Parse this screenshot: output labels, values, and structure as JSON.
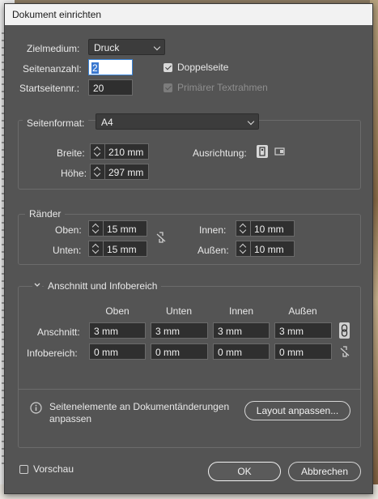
{
  "window": {
    "title": "Dokument einrichten"
  },
  "target": {
    "label": "Zielmedium:",
    "value": "Druck"
  },
  "pages": {
    "label": "Seitenanzahl:",
    "value": "2"
  },
  "start_page": {
    "label": "Startseitennr.:",
    "value": "20"
  },
  "facing_pages": {
    "label": "Doppelseite",
    "checked": true
  },
  "primary_text_frame": {
    "label": "Primärer Textrahmen",
    "checked": true,
    "disabled": true
  },
  "page_size": {
    "label": "Seitenformat:",
    "value": "A4",
    "width": {
      "label": "Breite:",
      "value": "210 mm"
    },
    "height": {
      "label": "Höhe:",
      "value": "297 mm"
    },
    "orientation": {
      "label": "Ausrichtung:",
      "portrait_icon": "portrait-orientation-icon",
      "landscape_icon": "landscape-orientation-icon",
      "selected": "portrait"
    }
  },
  "margins": {
    "title": "Ränder",
    "top": {
      "label": "Oben:",
      "value": "15 mm"
    },
    "bottom": {
      "label": "Unten:",
      "value": "15 mm"
    },
    "inside": {
      "label": "Innen:",
      "value": "10 mm"
    },
    "outside": {
      "label": "Außen:",
      "value": "10 mm"
    },
    "link_icon": "broken-link-icon"
  },
  "bleed_slug": {
    "title": "Anschnitt und Infobereich",
    "columns": [
      "Oben",
      "Unten",
      "Innen",
      "Außen"
    ],
    "bleed": {
      "label": "Anschnitt:",
      "values": [
        "3 mm",
        "3 mm",
        "3 mm",
        "3 mm"
      ],
      "link_icon": "link-icon"
    },
    "slug": {
      "label": "Infobereich:",
      "values": [
        "0 mm",
        "0 mm",
        "0 mm",
        "0 mm"
      ],
      "link_icon": "broken-link-icon"
    }
  },
  "adjust": {
    "text": "Seitenelemente an Dokumentänderungen anpassen",
    "info_icon": "info-icon",
    "button": "Layout anpassen..."
  },
  "preview": {
    "label": "Vorschau",
    "checked": false
  },
  "buttons": {
    "ok": "OK",
    "cancel": "Abbrechen"
  }
}
